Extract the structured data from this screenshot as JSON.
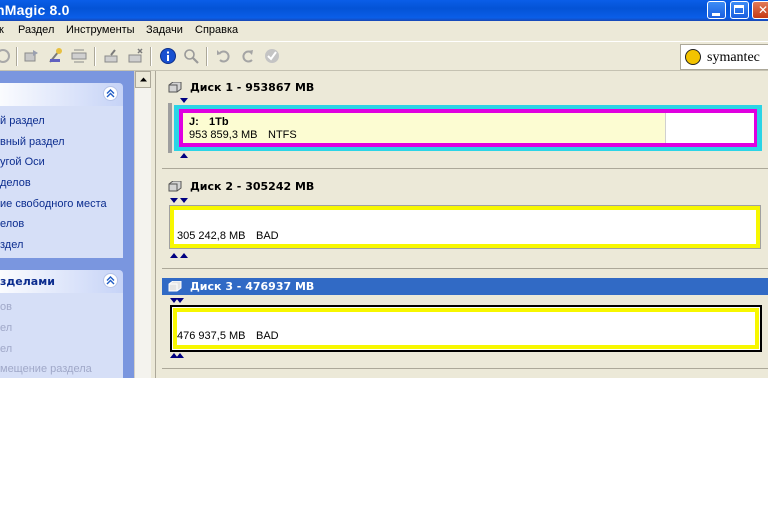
{
  "window": {
    "title": "nMagic 8.0"
  },
  "menu": [
    "к",
    "Раздел",
    "Инструменты",
    "Задачи",
    "Справка"
  ],
  "toolbar": {
    "icons": [
      "disk-icon",
      "copy-partition-icon",
      "wizard-icon",
      "resize-icon",
      "undo-extra-icon",
      "new-partition-icon",
      "info-icon",
      "zoom-icon",
      "undo-icon",
      "redo-icon",
      "apply-icon"
    ],
    "brand": "symantec"
  },
  "left_panel": {
    "section1": {
      "title": "",
      "items": [
        "й раздел",
        "вный раздел",
        "угой Оси",
        "делов",
        "ие свободного места",
        "елов",
        "здел"
      ]
    },
    "section2": {
      "title": "зделами",
      "items": [
        "ов",
        "ел",
        "ел",
        "мещение раздела"
      ]
    }
  },
  "disks": [
    {
      "title": "Диск 1 - 953867 MB",
      "partitions": [
        {
          "letter": "J:",
          "name": "1Tb",
          "size": "953 859,3 MB",
          "fs": "NTFS"
        }
      ]
    },
    {
      "title": "Диск 2 - 305242 MB",
      "partitions": [
        {
          "size": "305 242,8 MB",
          "fs": "BAD"
        }
      ]
    },
    {
      "title": "Диск 3 - 476937 MB",
      "selected": true,
      "partitions": [
        {
          "size": "476 937,5 MB",
          "fs": "BAD"
        }
      ]
    }
  ],
  "colors": {
    "title_bar": "#0a5ee8",
    "ntfs_border": "#e000e0",
    "bad_border": "#f7f700",
    "selected_disk": "#316ac5",
    "ntfs_fill": "#fcfcd2"
  }
}
